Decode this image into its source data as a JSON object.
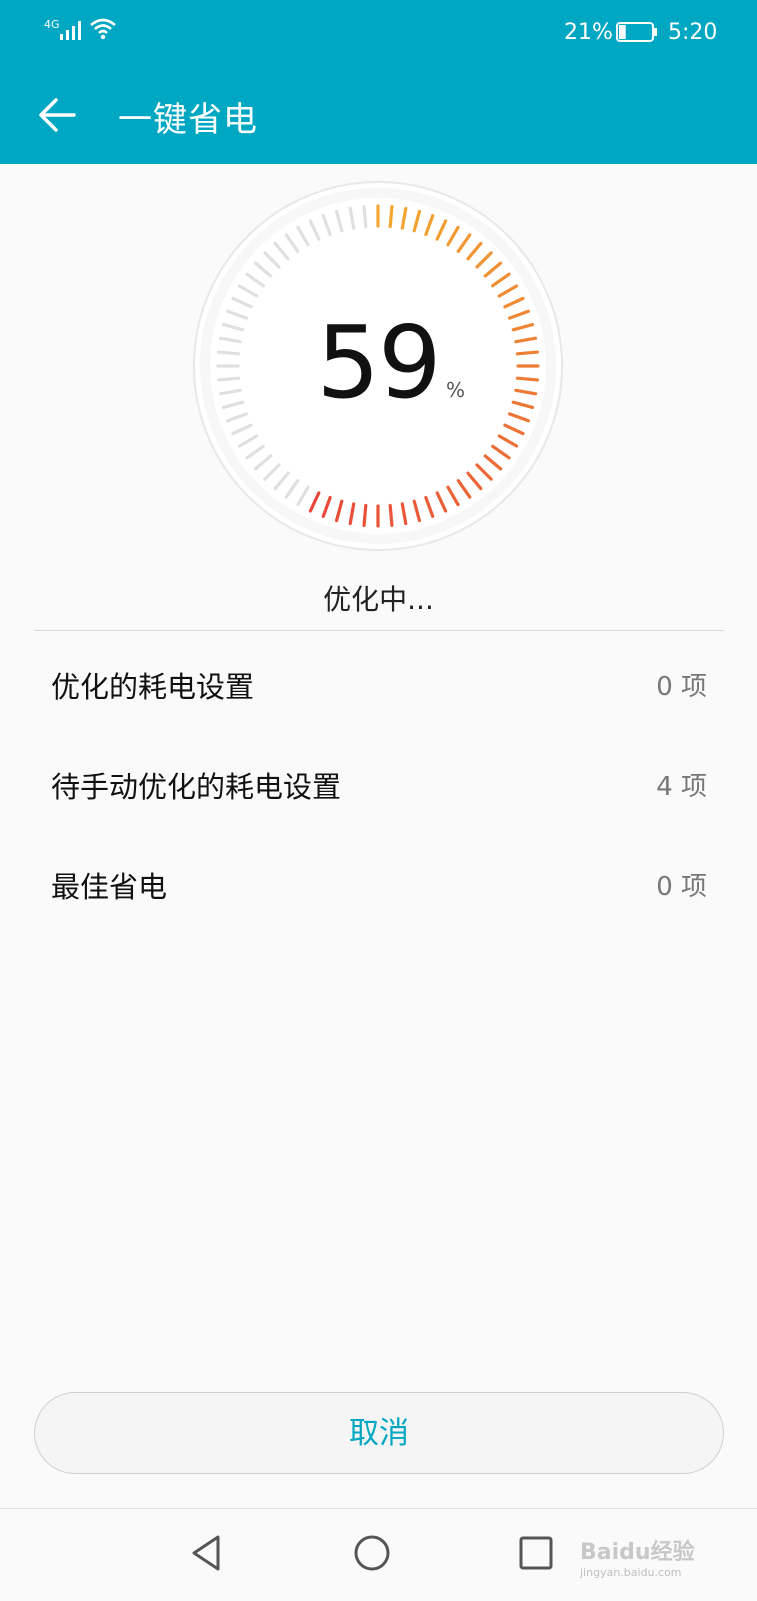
{
  "status_bar": {
    "network": "4G",
    "battery_percent": "21%",
    "battery_level": 0.21,
    "time": "5:20"
  },
  "header": {
    "title": "一键省电",
    "background_color": "#00a7c2"
  },
  "gauge": {
    "value": "59",
    "unit": "%",
    "progress_fraction": 0.59,
    "colors": {
      "inactive": "#e0e0e0",
      "start": "#e8483a",
      "end": "#f3a830"
    }
  },
  "status_text": "优化中...",
  "summary": [
    {
      "label": "优化的耗电设置",
      "count": "0 项"
    },
    {
      "label": "待手动优化的耗电设置",
      "count": "4 项"
    },
    {
      "label": "最佳省电",
      "count": "0 项"
    }
  ],
  "actions": {
    "cancel": "取消"
  },
  "watermark": {
    "brand": "Baidu经验",
    "url": "jingyan.baidu.com"
  }
}
